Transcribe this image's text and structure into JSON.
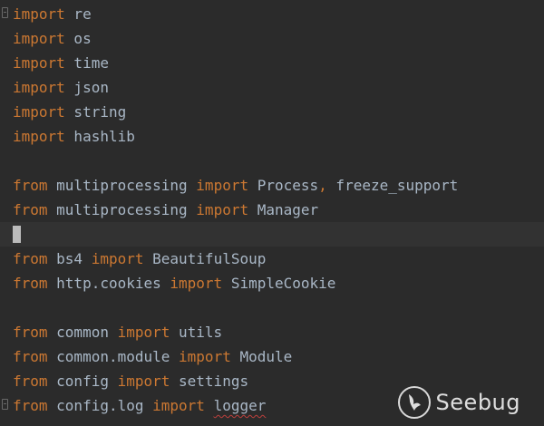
{
  "editor": {
    "lines": [
      {
        "keyword": "import",
        "module": " re"
      },
      {
        "keyword": "import",
        "module": " os"
      },
      {
        "keyword": "import",
        "module": " time"
      },
      {
        "keyword": "import",
        "module": " json"
      },
      {
        "keyword": "import",
        "module": " string"
      },
      {
        "keyword": "import",
        "module": " hashlib"
      },
      {},
      {
        "from": "from",
        "module": " multiprocessing ",
        "keyword": "import",
        "names": " Process",
        "comma": ",",
        "rest": " freeze_support"
      },
      {
        "from": "from",
        "module": " multiprocessing ",
        "keyword": "import",
        "names": " Manager"
      },
      {},
      {
        "from": "from",
        "module": " bs4 ",
        "keyword": "import",
        "names": " BeautifulSoup"
      },
      {
        "from": "from",
        "module": " http.cookies ",
        "keyword": "import",
        "names": " SimpleCookie"
      },
      {},
      {
        "from": "from",
        "module": " common ",
        "keyword": "import",
        "names": " utils"
      },
      {
        "from": "from",
        "module": " common.module ",
        "keyword": "import",
        "names": " Module"
      },
      {
        "from": "from",
        "module": " config ",
        "keyword": "import",
        "names": " settings"
      },
      {
        "from": "from",
        "module": " config.log ",
        "keyword": "import",
        "names": " ",
        "squiggle": "logger"
      }
    ]
  },
  "watermark": {
    "text": "Seebug",
    "icon": "seebug-logo-icon"
  },
  "colors": {
    "background": "#2b2b2b",
    "keyword": "#cc7832",
    "identifier": "#a9b7c6",
    "current_line": "#323232"
  }
}
